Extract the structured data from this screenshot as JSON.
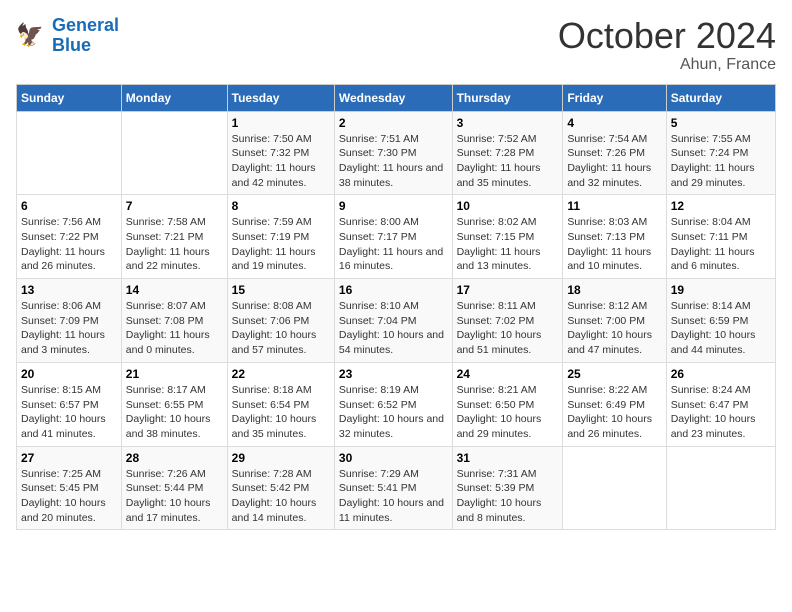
{
  "header": {
    "logo_line1": "General",
    "logo_line2": "Blue",
    "month": "October 2024",
    "location": "Ahun, France"
  },
  "weekdays": [
    "Sunday",
    "Monday",
    "Tuesday",
    "Wednesday",
    "Thursday",
    "Friday",
    "Saturday"
  ],
  "weeks": [
    [
      {
        "day": "",
        "sunrise": "",
        "sunset": "",
        "daylight": ""
      },
      {
        "day": "",
        "sunrise": "",
        "sunset": "",
        "daylight": ""
      },
      {
        "day": "1",
        "sunrise": "Sunrise: 7:50 AM",
        "sunset": "Sunset: 7:32 PM",
        "daylight": "Daylight: 11 hours and 42 minutes."
      },
      {
        "day": "2",
        "sunrise": "Sunrise: 7:51 AM",
        "sunset": "Sunset: 7:30 PM",
        "daylight": "Daylight: 11 hours and 38 minutes."
      },
      {
        "day": "3",
        "sunrise": "Sunrise: 7:52 AM",
        "sunset": "Sunset: 7:28 PM",
        "daylight": "Daylight: 11 hours and 35 minutes."
      },
      {
        "day": "4",
        "sunrise": "Sunrise: 7:54 AM",
        "sunset": "Sunset: 7:26 PM",
        "daylight": "Daylight: 11 hours and 32 minutes."
      },
      {
        "day": "5",
        "sunrise": "Sunrise: 7:55 AM",
        "sunset": "Sunset: 7:24 PM",
        "daylight": "Daylight: 11 hours and 29 minutes."
      }
    ],
    [
      {
        "day": "6",
        "sunrise": "Sunrise: 7:56 AM",
        "sunset": "Sunset: 7:22 PM",
        "daylight": "Daylight: 11 hours and 26 minutes."
      },
      {
        "day": "7",
        "sunrise": "Sunrise: 7:58 AM",
        "sunset": "Sunset: 7:21 PM",
        "daylight": "Daylight: 11 hours and 22 minutes."
      },
      {
        "day": "8",
        "sunrise": "Sunrise: 7:59 AM",
        "sunset": "Sunset: 7:19 PM",
        "daylight": "Daylight: 11 hours and 19 minutes."
      },
      {
        "day": "9",
        "sunrise": "Sunrise: 8:00 AM",
        "sunset": "Sunset: 7:17 PM",
        "daylight": "Daylight: 11 hours and 16 minutes."
      },
      {
        "day": "10",
        "sunrise": "Sunrise: 8:02 AM",
        "sunset": "Sunset: 7:15 PM",
        "daylight": "Daylight: 11 hours and 13 minutes."
      },
      {
        "day": "11",
        "sunrise": "Sunrise: 8:03 AM",
        "sunset": "Sunset: 7:13 PM",
        "daylight": "Daylight: 11 hours and 10 minutes."
      },
      {
        "day": "12",
        "sunrise": "Sunrise: 8:04 AM",
        "sunset": "Sunset: 7:11 PM",
        "daylight": "Daylight: 11 hours and 6 minutes."
      }
    ],
    [
      {
        "day": "13",
        "sunrise": "Sunrise: 8:06 AM",
        "sunset": "Sunset: 7:09 PM",
        "daylight": "Daylight: 11 hours and 3 minutes."
      },
      {
        "day": "14",
        "sunrise": "Sunrise: 8:07 AM",
        "sunset": "Sunset: 7:08 PM",
        "daylight": "Daylight: 11 hours and 0 minutes."
      },
      {
        "day": "15",
        "sunrise": "Sunrise: 8:08 AM",
        "sunset": "Sunset: 7:06 PM",
        "daylight": "Daylight: 10 hours and 57 minutes."
      },
      {
        "day": "16",
        "sunrise": "Sunrise: 8:10 AM",
        "sunset": "Sunset: 7:04 PM",
        "daylight": "Daylight: 10 hours and 54 minutes."
      },
      {
        "day": "17",
        "sunrise": "Sunrise: 8:11 AM",
        "sunset": "Sunset: 7:02 PM",
        "daylight": "Daylight: 10 hours and 51 minutes."
      },
      {
        "day": "18",
        "sunrise": "Sunrise: 8:12 AM",
        "sunset": "Sunset: 7:00 PM",
        "daylight": "Daylight: 10 hours and 47 minutes."
      },
      {
        "day": "19",
        "sunrise": "Sunrise: 8:14 AM",
        "sunset": "Sunset: 6:59 PM",
        "daylight": "Daylight: 10 hours and 44 minutes."
      }
    ],
    [
      {
        "day": "20",
        "sunrise": "Sunrise: 8:15 AM",
        "sunset": "Sunset: 6:57 PM",
        "daylight": "Daylight: 10 hours and 41 minutes."
      },
      {
        "day": "21",
        "sunrise": "Sunrise: 8:17 AM",
        "sunset": "Sunset: 6:55 PM",
        "daylight": "Daylight: 10 hours and 38 minutes."
      },
      {
        "day": "22",
        "sunrise": "Sunrise: 8:18 AM",
        "sunset": "Sunset: 6:54 PM",
        "daylight": "Daylight: 10 hours and 35 minutes."
      },
      {
        "day": "23",
        "sunrise": "Sunrise: 8:19 AM",
        "sunset": "Sunset: 6:52 PM",
        "daylight": "Daylight: 10 hours and 32 minutes."
      },
      {
        "day": "24",
        "sunrise": "Sunrise: 8:21 AM",
        "sunset": "Sunset: 6:50 PM",
        "daylight": "Daylight: 10 hours and 29 minutes."
      },
      {
        "day": "25",
        "sunrise": "Sunrise: 8:22 AM",
        "sunset": "Sunset: 6:49 PM",
        "daylight": "Daylight: 10 hours and 26 minutes."
      },
      {
        "day": "26",
        "sunrise": "Sunrise: 8:24 AM",
        "sunset": "Sunset: 6:47 PM",
        "daylight": "Daylight: 10 hours and 23 minutes."
      }
    ],
    [
      {
        "day": "27",
        "sunrise": "Sunrise: 7:25 AM",
        "sunset": "Sunset: 5:45 PM",
        "daylight": "Daylight: 10 hours and 20 minutes."
      },
      {
        "day": "28",
        "sunrise": "Sunrise: 7:26 AM",
        "sunset": "Sunset: 5:44 PM",
        "daylight": "Daylight: 10 hours and 17 minutes."
      },
      {
        "day": "29",
        "sunrise": "Sunrise: 7:28 AM",
        "sunset": "Sunset: 5:42 PM",
        "daylight": "Daylight: 10 hours and 14 minutes."
      },
      {
        "day": "30",
        "sunrise": "Sunrise: 7:29 AM",
        "sunset": "Sunset: 5:41 PM",
        "daylight": "Daylight: 10 hours and 11 minutes."
      },
      {
        "day": "31",
        "sunrise": "Sunrise: 7:31 AM",
        "sunset": "Sunset: 5:39 PM",
        "daylight": "Daylight: 10 hours and 8 minutes."
      },
      {
        "day": "",
        "sunrise": "",
        "sunset": "",
        "daylight": ""
      },
      {
        "day": "",
        "sunrise": "",
        "sunset": "",
        "daylight": ""
      }
    ]
  ]
}
